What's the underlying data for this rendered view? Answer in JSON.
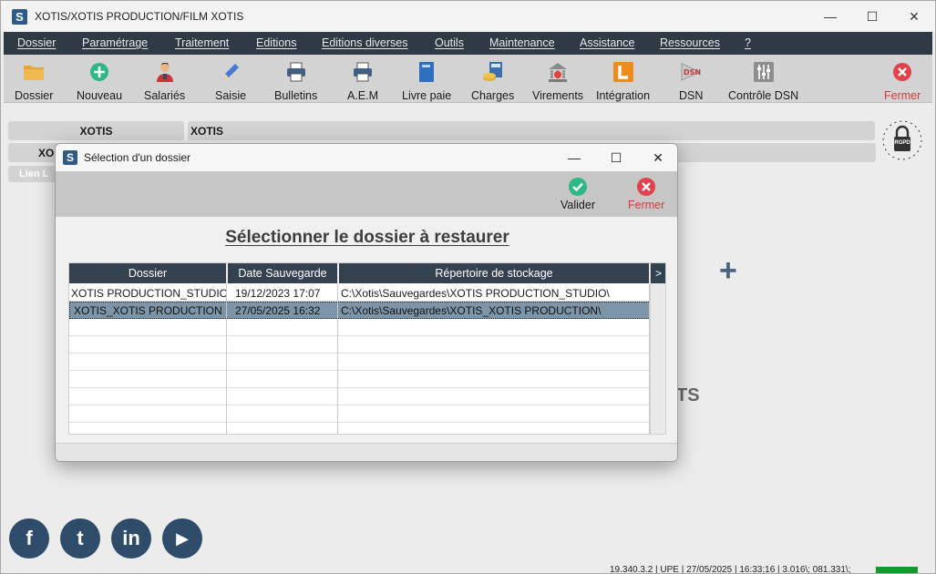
{
  "window": {
    "title": "XOTIS/XOTIS PRODUCTION/FILM XOTIS",
    "logo_letter": "S"
  },
  "menu": [
    "Dossier",
    "Paramétrage",
    "Traitement",
    "Editions",
    "Editions diverses",
    "Outils",
    "Maintenance",
    "Assistance",
    "Ressources",
    "?"
  ],
  "toolbar": {
    "items": [
      {
        "label": "Dossier",
        "icon": "folder-icon"
      },
      {
        "label": "Nouveau",
        "icon": "add-circle-icon"
      },
      {
        "label": "Salariés",
        "icon": "employee-icon"
      },
      {
        "label": "Saisie",
        "icon": "pencil-icon"
      },
      {
        "label": "Bulletins",
        "icon": "printer-icon"
      },
      {
        "label": "A.E.M",
        "icon": "printer-icon"
      },
      {
        "label": "Livre paie",
        "icon": "book-icon"
      },
      {
        "label": "Charges",
        "icon": "calculator-coins-icon"
      },
      {
        "label": "Virements",
        "icon": "bank-icon"
      },
      {
        "label": "Intégration",
        "icon": "l-square-icon"
      },
      {
        "label": "DSN",
        "icon": "dsn-icon"
      },
      {
        "label": "Contrôle DSN",
        "icon": "sliders-icon"
      },
      {
        "label": "Fermer",
        "icon": "close-circle-icon"
      }
    ]
  },
  "background": {
    "field1_label": "XOTIS",
    "field1_value": "XOTIS",
    "field2_label": "XO",
    "link_text": "Lien L",
    "rgpd_text": "RGPD",
    "partial_text": "TS",
    "plus": "+",
    "social": [
      "f",
      "t",
      "in",
      "▶"
    ],
    "status_text": "19.340.3.2 | UPE | 27/05/2025 | 16:33:16 | 3.016\\; 081.331\\;"
  },
  "dialog": {
    "title": "Sélection d'un dossier",
    "validate_label": "Valider",
    "close_label": "Fermer",
    "heading": "Sélectionner le dossier à restaurer",
    "columns": [
      "Dossier",
      "Date Sauvegarde",
      "Répertoire de stockage"
    ],
    "rows": [
      {
        "dossier": "XOTIS PRODUCTION_STUDIO",
        "date": "19/12/2023 17:07",
        "path": "C:\\Xotis\\Sauvegardes\\XOTIS PRODUCTION_STUDIO\\"
      },
      {
        "dossier": "XOTIS_XOTIS PRODUCTION",
        "date": "27/05/2025 16:32",
        "path": "C:\\Xotis\\Sauvegardes\\XOTIS_XOTIS PRODUCTION\\"
      }
    ],
    "scroll_arrow": ">"
  },
  "colors": {
    "menubar": "#2f3a44",
    "grid_header": "#34424f",
    "selected_row": "#7d95a8",
    "valid_green": "#2fb885",
    "close_red": "#e0434b",
    "social_blue": "#2f4d6b"
  }
}
